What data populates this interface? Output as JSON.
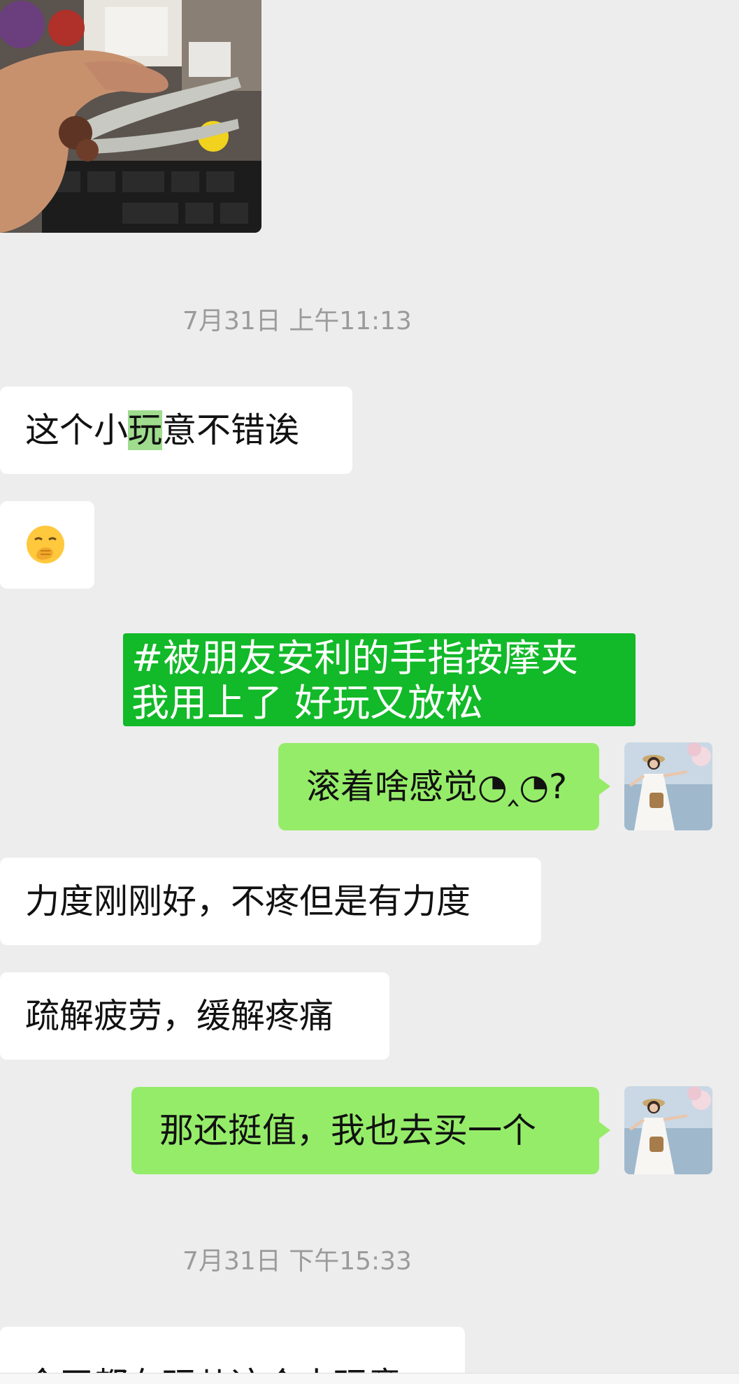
{
  "messages": {
    "timestamp_1": "7月31日 上午11:13",
    "msg_1_pre": "这个小",
    "msg_1_hl": "玩",
    "msg_1_post": "意不错诶",
    "banner_line_1": "#被朋友安利的手指按摩夹",
    "banner_line_2": "我用上了    好玩又放松",
    "msg_question": "滚着啥感觉◔‸◔?",
    "msg_reply_1": "力度刚刚好，不疼但是有力度",
    "msg_reply_2": "疏解疲劳，缓解疼痛",
    "msg_mine_2": "那还挺值，我也去买一个",
    "timestamp_2": "7月31日 下午15:33",
    "msg_last": "今天都在玩儿这个小玩意"
  },
  "icons": {
    "emoji": "hand-over-mouth-emoji",
    "avatar": "woman-in-white-dress-avatar",
    "photo": "hand-holding-finger-massager-photo"
  },
  "colors": {
    "background": "#ededed",
    "my_bubble": "#95ec69",
    "their_bubble": "#ffffff",
    "banner": "#12b928",
    "timestamp": "#9b9b9b"
  }
}
